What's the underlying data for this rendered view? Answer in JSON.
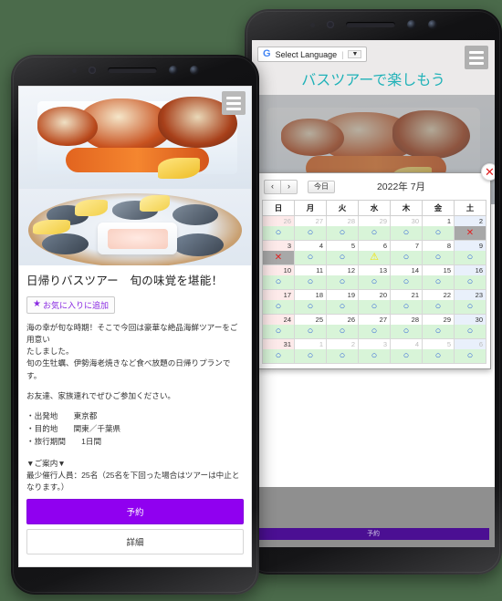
{
  "background_color": "#4b6b4b",
  "left_phone": {
    "menu_icon": "hamburger-icon",
    "title": "日帰りバスツアー　旬の味覚を堪能！",
    "favorite_button": {
      "icon": "star-icon",
      "label": "お気に入りに追加"
    },
    "paragraphs": [
      "海の幸が旬な時期！そこで今回は豪華な絶品海鮮ツアーをご用意い",
      "たしました。",
      "旬の生牡蠣、伊勢海老焼きなど食べ放題の日帰りプランです。"
    ],
    "paragraph2": "お友達、家族連れでぜひご参加ください。",
    "details": [
      "・出発地　　東京都",
      "・目的地　　関東／千葉県",
      "・旅行期間　　1日間"
    ],
    "guide_heading": "▼ご案内▼",
    "guide_text": "最少催行人員：25名（25名を下回った場合はツアーは中止となります。）",
    "buttons": {
      "reserve": "予約",
      "detail": "詳細"
    },
    "accent_color": "#9000f0"
  },
  "right_phone": {
    "language_selector": {
      "icon": "google-g-icon",
      "label": "Select Language",
      "caret": "▼"
    },
    "menu_icon": "hamburger-icon",
    "site_title": "バスツアーで楽しもう",
    "title_color": "#20b2b8",
    "bottom_reserve_label": "予約",
    "calendar": {
      "close_icon": "close-icon",
      "prev_label": "‹",
      "next_label": "›",
      "today_label": "今日",
      "month_label": "2022年 7月",
      "weekdays": [
        "日",
        "月",
        "火",
        "水",
        "木",
        "金",
        "土"
      ],
      "legend": {
        "available": "○",
        "full": "✕",
        "few": "⚠"
      },
      "weeks": [
        [
          {
            "day": "26",
            "mark": "o",
            "other": true
          },
          {
            "day": "27",
            "mark": "o",
            "other": true
          },
          {
            "day": "28",
            "mark": "o",
            "other": true
          },
          {
            "day": "29",
            "mark": "o",
            "other": true
          },
          {
            "day": "30",
            "mark": "o",
            "other": true
          },
          {
            "day": "1",
            "mark": "o",
            "other": false
          },
          {
            "day": "2",
            "mark": "x",
            "other": false
          }
        ],
        [
          {
            "day": "3",
            "mark": "x",
            "other": false
          },
          {
            "day": "4",
            "mark": "o",
            "other": false
          },
          {
            "day": "5",
            "mark": "o",
            "other": false
          },
          {
            "day": "6",
            "mark": "w",
            "other": false
          },
          {
            "day": "7",
            "mark": "o",
            "other": false
          },
          {
            "day": "8",
            "mark": "o",
            "other": false
          },
          {
            "day": "9",
            "mark": "o",
            "other": false
          }
        ],
        [
          {
            "day": "10",
            "mark": "o",
            "other": false
          },
          {
            "day": "11",
            "mark": "o",
            "other": false
          },
          {
            "day": "12",
            "mark": "o",
            "other": false
          },
          {
            "day": "13",
            "mark": "o",
            "other": false
          },
          {
            "day": "14",
            "mark": "o",
            "other": false
          },
          {
            "day": "15",
            "mark": "o",
            "other": false
          },
          {
            "day": "16",
            "mark": "o",
            "other": false
          }
        ],
        [
          {
            "day": "17",
            "mark": "o",
            "other": false
          },
          {
            "day": "18",
            "mark": "o",
            "other": false
          },
          {
            "day": "19",
            "mark": "o",
            "other": false
          },
          {
            "day": "20",
            "mark": "o",
            "other": false
          },
          {
            "day": "21",
            "mark": "o",
            "other": false
          },
          {
            "day": "22",
            "mark": "o",
            "other": false
          },
          {
            "day": "23",
            "mark": "o",
            "other": false
          }
        ],
        [
          {
            "day": "24",
            "mark": "o",
            "other": false
          },
          {
            "day": "25",
            "mark": "o",
            "other": false
          },
          {
            "day": "26",
            "mark": "o",
            "other": false
          },
          {
            "day": "27",
            "mark": "o",
            "other": false
          },
          {
            "day": "28",
            "mark": "o",
            "other": false
          },
          {
            "day": "29",
            "mark": "o",
            "other": false
          },
          {
            "day": "30",
            "mark": "o",
            "other": false
          }
        ],
        [
          {
            "day": "31",
            "mark": "o",
            "other": false
          },
          {
            "day": "1",
            "mark": "o",
            "other": true
          },
          {
            "day": "2",
            "mark": "o",
            "other": true
          },
          {
            "day": "3",
            "mark": "o",
            "other": true
          },
          {
            "day": "4",
            "mark": "o",
            "other": true
          },
          {
            "day": "5",
            "mark": "o",
            "other": true
          },
          {
            "day": "6",
            "mark": "o",
            "other": true
          }
        ]
      ]
    }
  }
}
